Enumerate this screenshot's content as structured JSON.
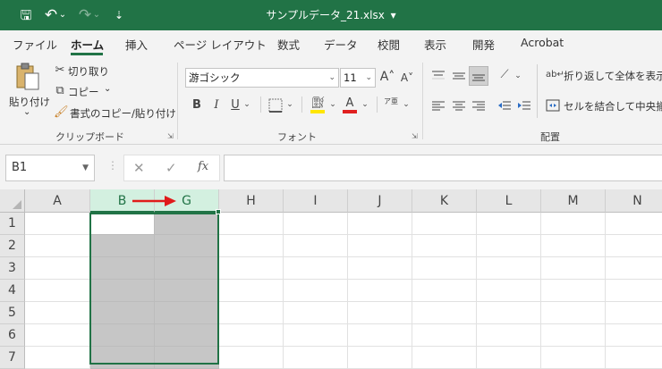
{
  "title": {
    "filename": "サンプルデータ_21.xlsx",
    "dropdown": "▾"
  },
  "qat": {
    "save": "🖫",
    "undo": "↶",
    "undo_arrow": "⌄",
    "redo": "↷",
    "redo_arrow": "⌄",
    "customize": "⇣"
  },
  "tabs": [
    "ファイル",
    "ホーム",
    "挿入",
    "ページ レイアウト",
    "数式",
    "データ",
    "校閲",
    "表示",
    "開発",
    "Acrobat"
  ],
  "active_tab": "ホーム",
  "ribbon": {
    "clipboard": {
      "paste_label": "貼り付け",
      "paste_arrow": "⌄",
      "cut_label": "切り取り",
      "copy_label": "コピー",
      "copy_arrow": "⌄",
      "format_painter_label": "書式のコピー/貼り付け",
      "group_label": "クリップボード"
    },
    "font": {
      "font_name": "游ゴシック",
      "font_size": "11",
      "grow": "A˄",
      "shrink": "A˅",
      "bold": "B",
      "italic": "I",
      "underline": "U",
      "underline_arrow": "⌄",
      "border_arrow": "⌄",
      "fill_arrow": "⌄",
      "font_color": "A",
      "font_color_arrow": "⌄",
      "phonetic": "ア亜",
      "phonetic_arrow": "⌄",
      "group_label": "フォント"
    },
    "alignment": {
      "wrap_label": "折り返して全体を表示する",
      "merge_label": "セルを結合して中央揃え",
      "group_label": "配置"
    }
  },
  "formula_bar": {
    "name_box": "B1",
    "cancel": "✕",
    "enter": "✓",
    "fx": "fx",
    "value": ""
  },
  "columns": [
    "A",
    "B",
    "G",
    "H",
    "I",
    "J",
    "K",
    "L",
    "M",
    "N"
  ],
  "rows": [
    "1",
    "2",
    "3",
    "4",
    "5",
    "6",
    "7"
  ],
  "colors": {
    "accent": "#217346",
    "selection_fill": "#c6c6c6",
    "arrow": "#e01b1b",
    "highlight_yellow": "#ffe600",
    "font_red": "#e02020"
  }
}
